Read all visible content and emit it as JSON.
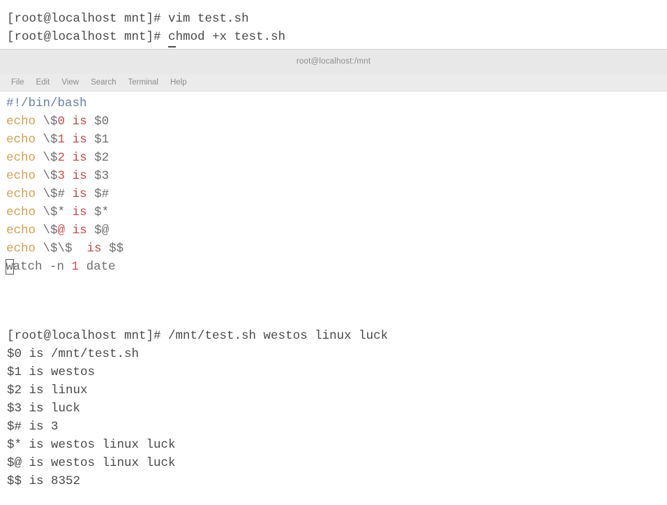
{
  "window": {
    "title": "root@localhost:/mnt",
    "menu": [
      "File",
      "Edit",
      "View",
      "Search",
      "Terminal",
      "Help"
    ]
  },
  "colors": {
    "background": "#ffffff",
    "titlebar_bg": "#e8e8e8",
    "menubar_bg": "#ebebeb",
    "text": "#4a4a4a",
    "menu_text": "#8c8c8c",
    "title_text": "#8d8d8d",
    "vim_comment": "#6a7fa8",
    "vim_builtin": "#d1a054",
    "vim_string": "#c4494b",
    "vim_number": "#d24b4b",
    "vim_plain": "#6e6e6e"
  },
  "top_shell": {
    "lines": [
      {
        "prompt": "[root@localhost mnt]# ",
        "command": "vim test.sh",
        "cursor": false
      },
      {
        "prompt": "[root@localhost mnt]# ",
        "command": "chmod +x test.sh",
        "cursor": true,
        "cursor_char": "c",
        "command_rest": "hmod +x test.sh"
      }
    ]
  },
  "vim": {
    "lines": [
      {
        "id": "shebang",
        "segments": [
          {
            "t": "#!/bin/bash",
            "c": "tok-comment"
          }
        ]
      },
      {
        "id": "echo0",
        "segments": [
          {
            "t": "echo ",
            "c": "tok-builtin"
          },
          {
            "t": "\\$",
            "c": "tok-plain"
          },
          {
            "t": "0",
            "c": "tok-num"
          },
          {
            "t": " ",
            "c": "tok-plain"
          },
          {
            "t": "is",
            "c": "tok-str"
          },
          {
            "t": " $0",
            "c": "tok-plain"
          }
        ]
      },
      {
        "id": "echo1",
        "segments": [
          {
            "t": "echo ",
            "c": "tok-builtin"
          },
          {
            "t": "\\$",
            "c": "tok-plain"
          },
          {
            "t": "1",
            "c": "tok-num"
          },
          {
            "t": " ",
            "c": "tok-plain"
          },
          {
            "t": "is",
            "c": "tok-str"
          },
          {
            "t": " $1",
            "c": "tok-plain"
          }
        ]
      },
      {
        "id": "echo2",
        "segments": [
          {
            "t": "echo ",
            "c": "tok-builtin"
          },
          {
            "t": "\\$",
            "c": "tok-plain"
          },
          {
            "t": "2",
            "c": "tok-num"
          },
          {
            "t": " ",
            "c": "tok-plain"
          },
          {
            "t": "is",
            "c": "tok-str"
          },
          {
            "t": " $2",
            "c": "tok-plain"
          }
        ]
      },
      {
        "id": "echo3",
        "segments": [
          {
            "t": "echo ",
            "c": "tok-builtin"
          },
          {
            "t": "\\$",
            "c": "tok-plain"
          },
          {
            "t": "3",
            "c": "tok-num"
          },
          {
            "t": " ",
            "c": "tok-plain"
          },
          {
            "t": "is",
            "c": "tok-str"
          },
          {
            "t": " $3",
            "c": "tok-plain"
          }
        ]
      },
      {
        "id": "echohash",
        "segments": [
          {
            "t": "echo ",
            "c": "tok-builtin"
          },
          {
            "t": "\\$#",
            "c": "tok-plain"
          },
          {
            "t": " ",
            "c": "tok-plain"
          },
          {
            "t": "is",
            "c": "tok-str"
          },
          {
            "t": " $#",
            "c": "tok-plain"
          }
        ]
      },
      {
        "id": "echostar",
        "segments": [
          {
            "t": "echo ",
            "c": "tok-builtin"
          },
          {
            "t": "\\$*",
            "c": "tok-plain"
          },
          {
            "t": " ",
            "c": "tok-plain"
          },
          {
            "t": "is",
            "c": "tok-str"
          },
          {
            "t": " $*",
            "c": "tok-plain"
          }
        ]
      },
      {
        "id": "echoat",
        "segments": [
          {
            "t": "echo ",
            "c": "tok-builtin"
          },
          {
            "t": "\\$",
            "c": "tok-plain"
          },
          {
            "t": "@",
            "c": "tok-num"
          },
          {
            "t": " ",
            "c": "tok-plain"
          },
          {
            "t": "is",
            "c": "tok-str"
          },
          {
            "t": " $@",
            "c": "tok-plain"
          }
        ]
      },
      {
        "id": "echodollar",
        "segments": [
          {
            "t": "echo ",
            "c": "tok-builtin"
          },
          {
            "t": "\\$\\$",
            "c": "tok-plain"
          },
          {
            "t": "  ",
            "c": "tok-plain"
          },
          {
            "t": "is",
            "c": "tok-str"
          },
          {
            "t": " $$",
            "c": "tok-plain"
          }
        ]
      },
      {
        "id": "watch",
        "cursor_char": "w",
        "segments": [
          {
            "t": "atch ",
            "c": "tok-plain"
          },
          {
            "t": "-n ",
            "c": "tok-plain"
          },
          {
            "t": "1",
            "c": "tok-num"
          },
          {
            "t": " date",
            "c": "tok-plain"
          }
        ]
      }
    ]
  },
  "output_shell": {
    "lines": [
      "[root@localhost mnt]# /mnt/test.sh westos linux luck",
      "$0 is /mnt/test.sh",
      "$1 is westos",
      "$2 is linux",
      "$3 is luck",
      "$# is 3",
      "$* is westos linux luck",
      "$@ is westos linux luck",
      "$$ is 8352"
    ]
  }
}
